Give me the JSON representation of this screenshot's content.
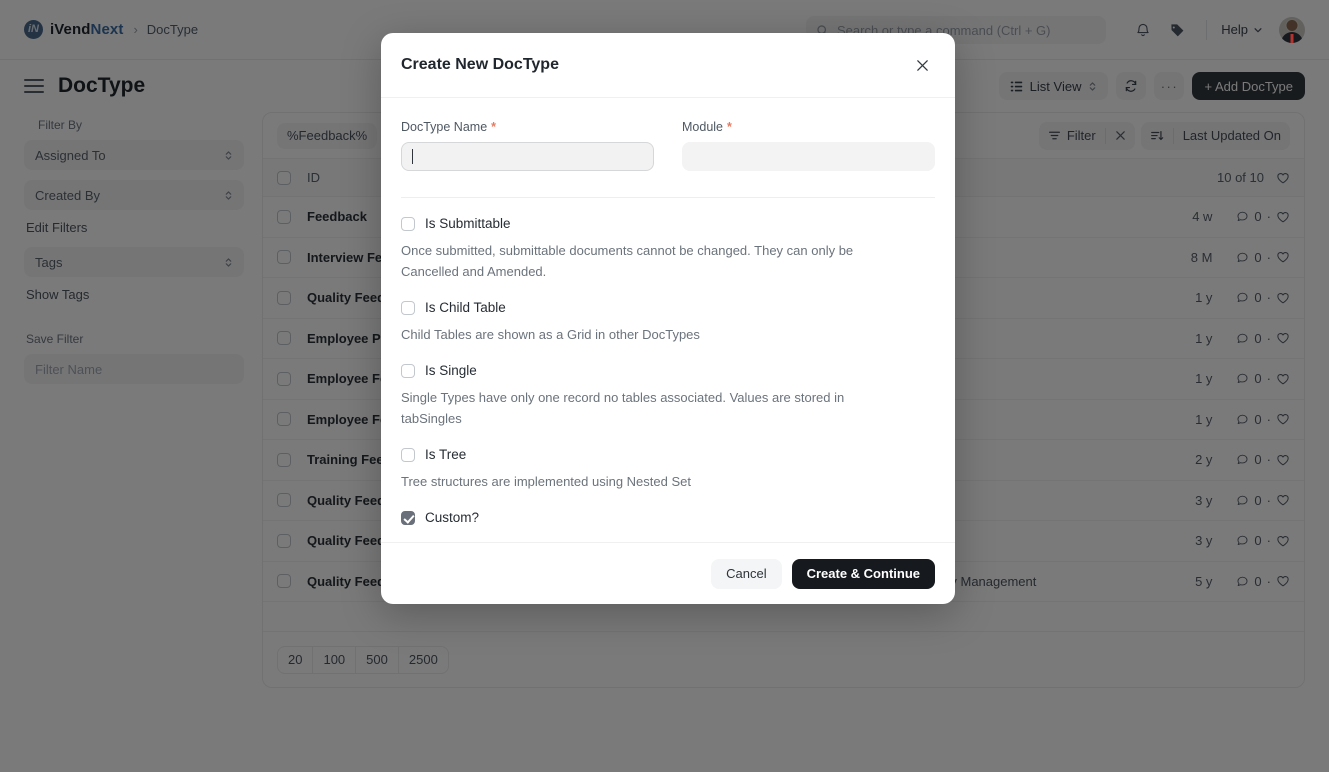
{
  "navbar": {
    "brand_first": "iVend",
    "brand_second": "Next",
    "breadcrumb": "DocType",
    "search_placeholder": "Search or type a command (Ctrl + G)",
    "help_label": "Help"
  },
  "page_header": {
    "title": "DocType",
    "list_view_label": "List View",
    "add_button_label": "+ Add DocType"
  },
  "sidebar": {
    "filter_by_label": "Filter By",
    "assigned_to": "Assigned To",
    "created_by": "Created By",
    "edit_filters": "Edit Filters",
    "tags": "Tags",
    "show_tags": "Show Tags",
    "save_filter_label": "Save Filter",
    "filter_name_placeholder": "Filter Name"
  },
  "list": {
    "tag_chip": "%Feedback%",
    "filter_label": "Filter",
    "sort_label": "Last Updated On",
    "id_header": "ID",
    "count_label": "10 of 10",
    "rows": [
      {
        "name": "Feedback",
        "module": "",
        "age": "4 w",
        "comments": "0"
      },
      {
        "name": "Interview Feedback",
        "module": "",
        "age": "8 M",
        "comments": "0"
      },
      {
        "name": "Quality Feedback",
        "module": "",
        "age": "1 y",
        "comments": "0"
      },
      {
        "name": "Employee Performance Feedback",
        "module": "",
        "age": "1 y",
        "comments": "0"
      },
      {
        "name": "Employee Feedback Rating",
        "module": "",
        "age": "1 y",
        "comments": "0"
      },
      {
        "name": "Employee Feedback Criteria",
        "module": "",
        "age": "1 y",
        "comments": "0"
      },
      {
        "name": "Training Feedback",
        "module": "",
        "age": "2 y",
        "comments": "0"
      },
      {
        "name": "Quality Feedback Parameter",
        "module": "",
        "age": "3 y",
        "comments": "0"
      },
      {
        "name": "Quality Feedback Template",
        "module": "",
        "age": "3 y",
        "comments": "0"
      },
      {
        "name": "Quality Feedback Template Parameter",
        "module": "Quality Management",
        "age": "5 y",
        "comments": "0"
      }
    ],
    "page_sizes": [
      "20",
      "100",
      "500",
      "2500"
    ]
  },
  "modal": {
    "title": "Create New DocType",
    "doctype_name_label": "DocType Name",
    "doctype_name_required": "*",
    "doctype_name_value": "",
    "module_label": "Module",
    "module_required": "*",
    "module_value": "",
    "options": [
      {
        "label": "Is Submittable",
        "checked": false,
        "help": "Once submitted, submittable documents cannot be changed. They can only be Cancelled and Amended."
      },
      {
        "label": "Is Child Table",
        "checked": false,
        "help": "Child Tables are shown as a Grid in other DocTypes"
      },
      {
        "label": "Is Single",
        "checked": false,
        "help": "Single Types have only one record no tables associated. Values are stored in tabSingles"
      },
      {
        "label": "Is Tree",
        "checked": false,
        "help": "Tree structures are implemented using Nested Set"
      },
      {
        "label": "Custom?",
        "checked": true,
        "help": ""
      }
    ],
    "cancel_label": "Cancel",
    "submit_label": "Create & Continue"
  },
  "colors": {
    "accent": "#3c6ea5",
    "primary_button": "#16191d",
    "required": "#e8795f",
    "overlay": "rgba(0,0,0,0.52)"
  }
}
